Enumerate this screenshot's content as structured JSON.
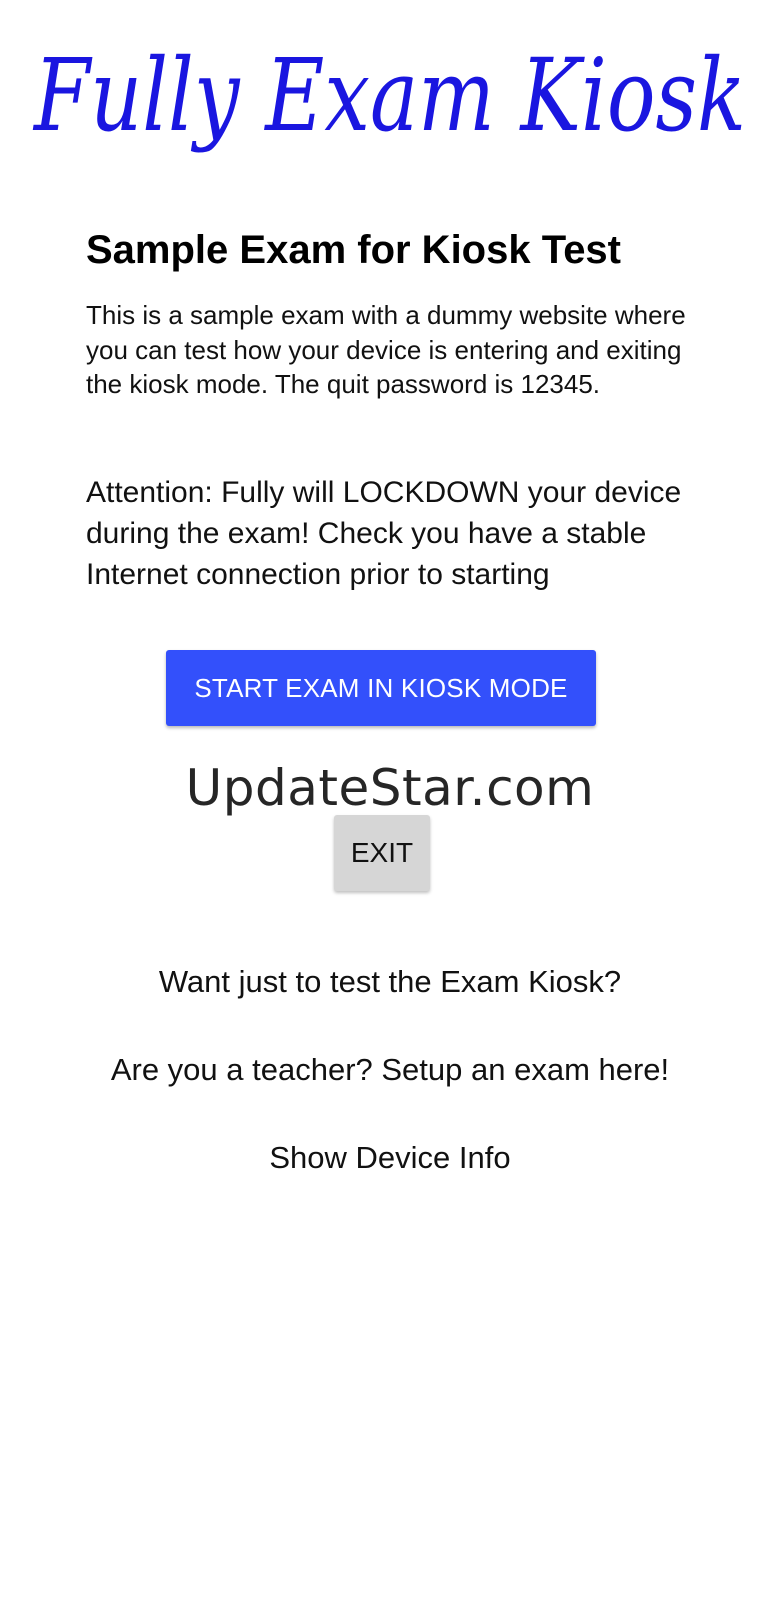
{
  "logo": {
    "text": "Fully Exam Kiosk",
    "color": "#1a16e0"
  },
  "exam": {
    "title": "Sample Exam for Kiosk Test",
    "description": "This is a sample exam with a dummy website where you can test how your device is entering and exiting the kiosk mode. The quit password is 12345.",
    "attention": "Attention: Fully will LOCKDOWN your device during the exam! Check you have a stable Internet connection prior to starting"
  },
  "buttons": {
    "start_label": "START EXAM IN KIOSK MODE",
    "start_color": "#3350fb",
    "exit_label": "EXIT",
    "exit_color": "#d6d6d6"
  },
  "watermark": {
    "text": "UpdateStar.com"
  },
  "links": {
    "test_kiosk": "Want just to test the Exam Kiosk?",
    "teacher_setup": "Are you a teacher? Setup an exam here!",
    "device_info": "Show Device Info"
  }
}
